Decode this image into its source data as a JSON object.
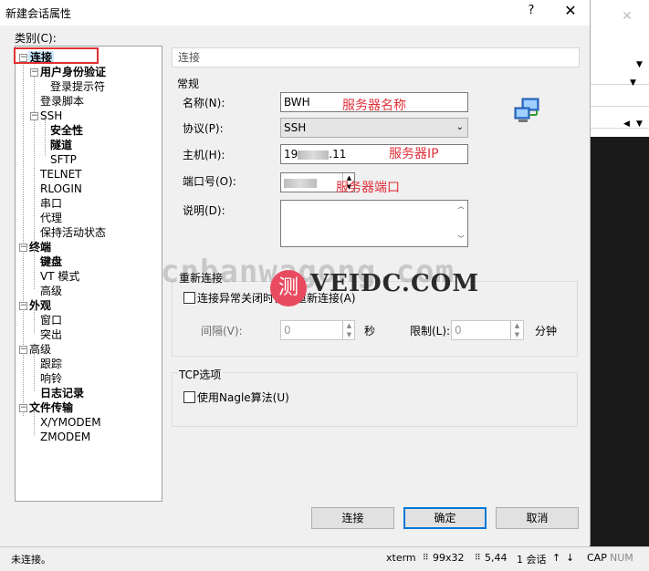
{
  "dialog": {
    "title": "新建会话属性",
    "help": "?",
    "close": "✕"
  },
  "category_label": "类别(C):",
  "tree": [
    {
      "label": "连接",
      "bold": true,
      "selected": true
    },
    {
      "label": "用户身份验证",
      "bold": true
    },
    {
      "label": "登录提示符"
    },
    {
      "label": "登录脚本"
    },
    {
      "label": "SSH"
    },
    {
      "label": "安全性",
      "bold": true
    },
    {
      "label": "隧道",
      "bold": true
    },
    {
      "label": "SFTP"
    },
    {
      "label": "TELNET"
    },
    {
      "label": "RLOGIN"
    },
    {
      "label": "串口"
    },
    {
      "label": "代理"
    },
    {
      "label": "保持活动状态"
    },
    {
      "label": "终端",
      "bold": true
    },
    {
      "label": "键盘",
      "bold": true
    },
    {
      "label": "VT 模式"
    },
    {
      "label": "高级"
    },
    {
      "label": "外观",
      "bold": true
    },
    {
      "label": "窗口"
    },
    {
      "label": "突出"
    },
    {
      "label": "高级"
    },
    {
      "label": "跟踪"
    },
    {
      "label": "响铃"
    },
    {
      "label": "日志记录",
      "bold": true
    },
    {
      "label": "文件传输",
      "bold": true
    },
    {
      "label": "X/YMODEM"
    },
    {
      "label": "ZMODEM"
    }
  ],
  "panel": {
    "header": "连接",
    "general_title": "常规",
    "name_label": "名称(N):",
    "name_value": "BWH",
    "name_note": "服务器名称",
    "protocol_label": "协议(P):",
    "protocol_value": "SSH",
    "host_label": "主机(H):",
    "host_value_prefix": "19",
    "host_value_suffix": ".11",
    "host_note": "服务器IP",
    "port_label": "端口号(O):",
    "port_note": "服务器端口",
    "desc_label": "说明(D):",
    "reconnect_title": "重新连接",
    "reconnect_check": "连接异常关闭时自动重新连接(A)",
    "interval_label": "间隔(V):",
    "interval_value": "0",
    "interval_unit": "秒",
    "limit_label": "限制(L):",
    "limit_value": "0",
    "limit_unit": "分钟",
    "tcp_title": "TCP选项",
    "nagle_check": "使用Nagle算法(U)"
  },
  "buttons": {
    "connect": "连接",
    "ok": "确定",
    "cancel": "取消"
  },
  "watermark": {
    "text": "cnbanwagong.com",
    "logo": "测",
    "brand": "VEIDC.COM"
  },
  "statusbar": {
    "status": "未连接。",
    "term": "xterm",
    "size": "99x32",
    "pos": "5,44",
    "sessions": "1 会话",
    "caps": "CAP",
    "num": "NUM"
  },
  "colors": {
    "selection": "#cce8ff",
    "annotation_red": "#e0303a",
    "focus_blue": "#0078d7"
  }
}
